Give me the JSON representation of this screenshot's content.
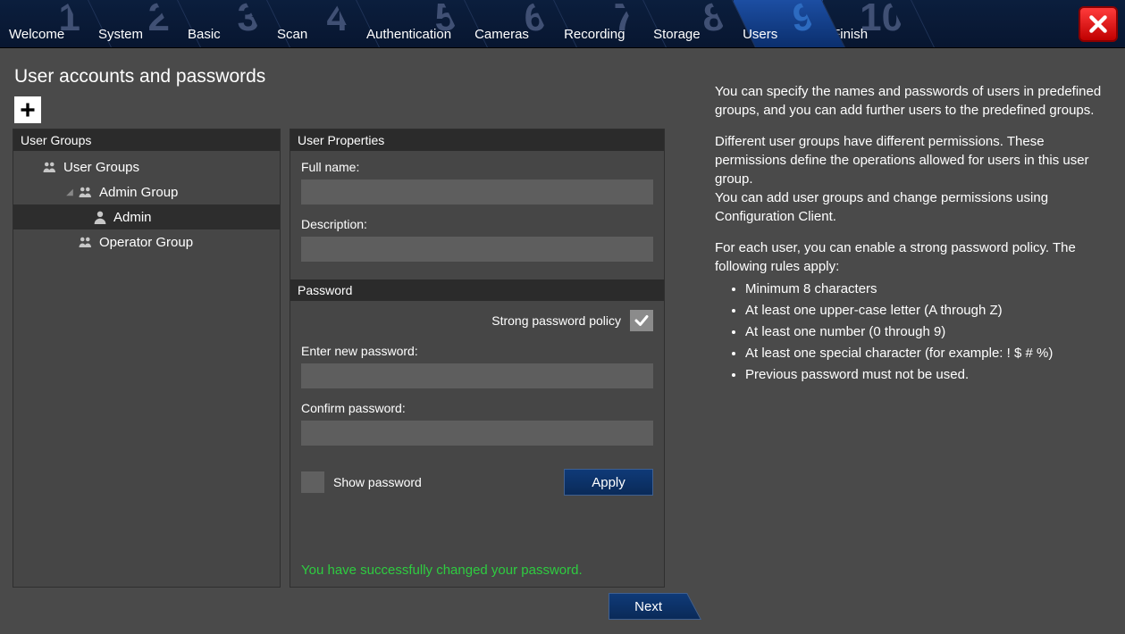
{
  "steps": [
    {
      "num": "1",
      "label": "Welcome"
    },
    {
      "num": "2",
      "label": "System"
    },
    {
      "num": "3",
      "label": "Basic"
    },
    {
      "num": "4",
      "label": "Scan"
    },
    {
      "num": "5",
      "label": "Authentication"
    },
    {
      "num": "6",
      "label": "Cameras"
    },
    {
      "num": "7",
      "label": "Recording"
    },
    {
      "num": "8",
      "label": "Storage"
    },
    {
      "num": "9",
      "label": "Users"
    },
    {
      "num": "10",
      "label": "Finish"
    }
  ],
  "active_step_index": 8,
  "page_title": "User accounts and passwords",
  "tree_header": "User Groups",
  "tree": {
    "root": "User Groups",
    "admin_group": "Admin Group",
    "admin_user": "Admin",
    "operator_group": "Operator Group"
  },
  "selected_tree_node": "admin_user",
  "props": {
    "header": "User Properties",
    "fullname_label": "Full name:",
    "fullname_value": "",
    "description_label": "Description:",
    "description_value": ""
  },
  "password": {
    "header": "Password",
    "policy_label": "Strong password policy",
    "policy_checked": true,
    "enter_label": "Enter new password:",
    "enter_value": "",
    "confirm_label": "Confirm password:",
    "confirm_value": "",
    "show_label": "Show password",
    "show_checked": false,
    "apply_label": "Apply",
    "status": "You have successfully changed your password."
  },
  "help": {
    "p1": "You can specify the names and passwords of users in predefined groups, and you can add further users to the predefined groups.",
    "p2a": "Different user groups have different permissions. These permissions define the operations allowed for users in this user group.",
    "p2b": "You can add user groups and change permissions using Configuration Client.",
    "p3": "For each user, you can enable a strong password policy. The following rules apply:",
    "rules": [
      "Minimum 8 characters",
      "At least one upper-case letter (A through Z)",
      "At least one number (0 through 9)",
      "At least one special character (for example: ! $ # %)",
      "Previous password must not be used."
    ]
  },
  "next_label": "Next"
}
